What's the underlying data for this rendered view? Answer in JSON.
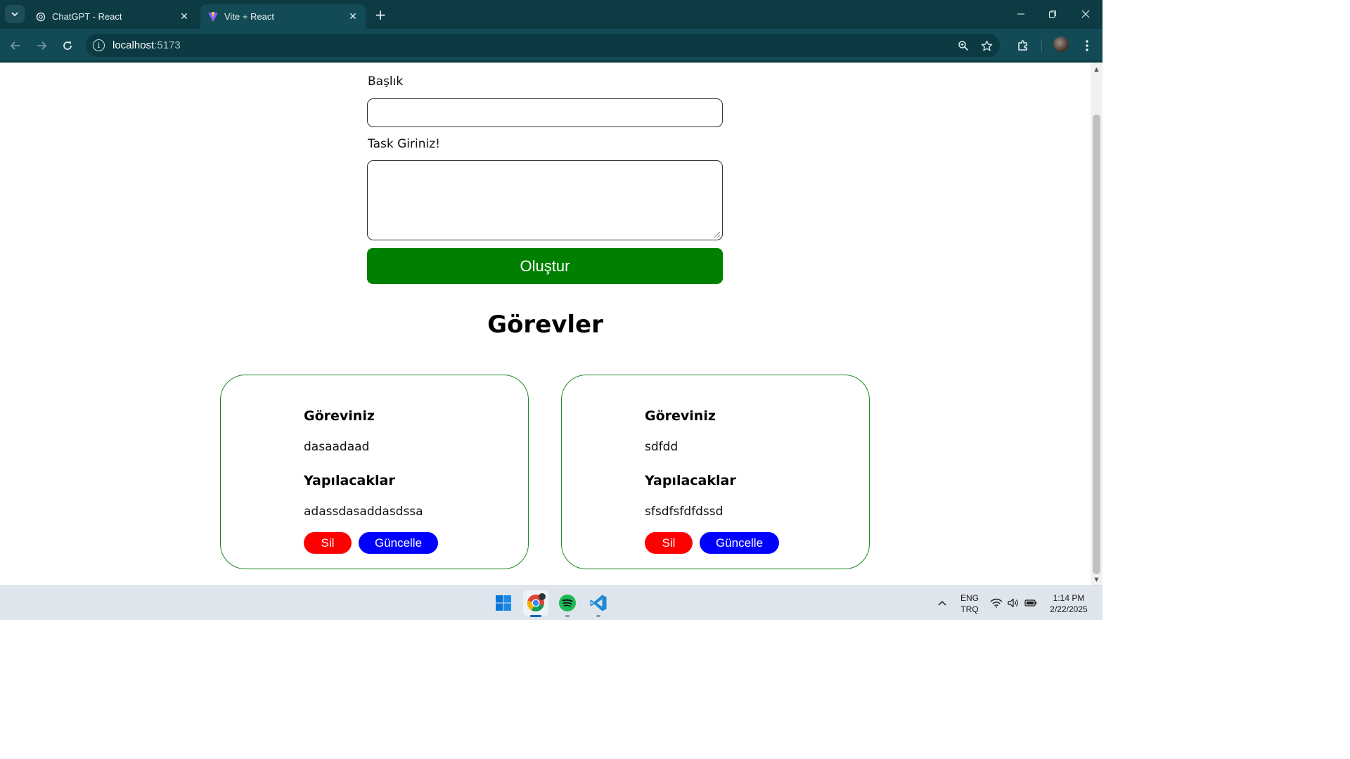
{
  "browser": {
    "tabs": [
      {
        "title": "ChatGPT - React",
        "active": false,
        "favicon": "openai-icon"
      },
      {
        "title": "Vite + React",
        "active": true,
        "favicon": "vite-icon"
      }
    ],
    "url_host": "localhost",
    "url_port": ":5173"
  },
  "form": {
    "title_label": "Başlık",
    "title_value": "",
    "task_label": "Task Giriniz!",
    "task_value": "",
    "create_button": "Oluştur"
  },
  "tasks_heading": "Görevler",
  "cards": [
    {
      "task_heading": "Göreviniz",
      "task_value": "dasaadaad",
      "todo_heading": "Yapılacaklar",
      "todo_value": "adassdasaddasdssa",
      "delete_label": "Sil",
      "update_label": "Güncelle"
    },
    {
      "task_heading": "Göreviniz",
      "task_value": "sdfdd",
      "todo_heading": "Yapılacaklar",
      "todo_value": "sfsdfsfdfdssd",
      "delete_label": "Sil",
      "update_label": "Güncelle"
    }
  ],
  "taskbar": {
    "lang_line1": "ENG",
    "lang_line2": "TRQ",
    "time": "1:14 PM",
    "date": "2/22/2025"
  },
  "colors": {
    "create_button": "#008000",
    "delete_button": "#ff0000",
    "update_button": "#0000ff",
    "card_border": "#1f8a1f",
    "chrome": "#124b55"
  }
}
